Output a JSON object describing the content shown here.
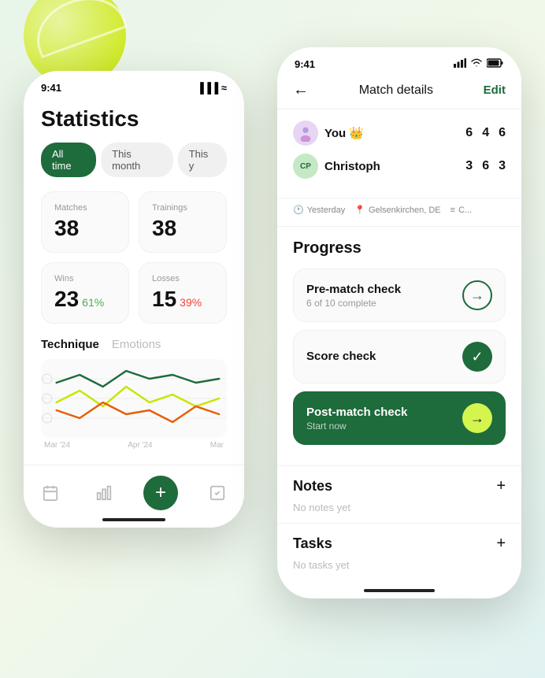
{
  "decoration": {
    "tennis_ball": "tennis-ball"
  },
  "left_phone": {
    "status_bar": {
      "time": "9:41",
      "signal": "▐▐▐",
      "wifi": "wifi"
    },
    "title": "Statistics",
    "filter_tabs": [
      {
        "label": "All time",
        "active": true
      },
      {
        "label": "This month",
        "active": false
      },
      {
        "label": "This y",
        "active": false
      }
    ],
    "stats": [
      {
        "label": "Matches",
        "value": "38",
        "percent": null
      },
      {
        "label": "Trainings",
        "value": "38",
        "percent": null
      },
      {
        "label": "Wins",
        "value": "23",
        "percent": "61%",
        "percent_color": "green"
      },
      {
        "label": "Losses",
        "value": "15",
        "percent": "39%",
        "percent_color": "red"
      }
    ],
    "chart_tabs": [
      {
        "label": "Technique",
        "active": true
      },
      {
        "label": "Emotions",
        "active": false
      }
    ],
    "chart_labels": [
      "Mar '24",
      "Apr '24",
      "Mar"
    ],
    "nav": [
      {
        "icon": "📅",
        "label": "calendar"
      },
      {
        "icon": "📊",
        "label": "stats"
      },
      {
        "icon": "+",
        "label": "add",
        "active": true
      },
      {
        "icon": "✓",
        "label": "tasks"
      }
    ]
  },
  "right_phone": {
    "status_bar": {
      "time": "9:41",
      "signal": "▐▐▐",
      "wifi": "wifi",
      "battery": "battery"
    },
    "header": {
      "back_icon": "←",
      "title": "Match details",
      "edit_label": "Edit"
    },
    "players": [
      {
        "name": "You",
        "avatar_type": "photo",
        "crown": true,
        "scores": [
          "6",
          "4",
          "6"
        ]
      },
      {
        "name": "Christoph",
        "avatar_type": "initials",
        "initials": "CP",
        "crown": false,
        "scores": [
          "3",
          "6",
          "3"
        ]
      }
    ],
    "match_meta": [
      {
        "icon": "🕐",
        "text": "Yesterday"
      },
      {
        "icon": "📍",
        "text": "Gelsenkirchen, DE"
      },
      {
        "icon": "≡",
        "text": "C..."
      }
    ],
    "progress": {
      "section_title": "Progress",
      "items": [
        {
          "title": "Pre-match check",
          "subtitle": "6 of 10 complete",
          "btn_type": "outline",
          "btn_icon": "→"
        },
        {
          "title": "Score check",
          "subtitle": null,
          "btn_type": "check",
          "btn_icon": "✓"
        },
        {
          "title": "Post-match check",
          "subtitle": "Start now",
          "btn_type": "yellow",
          "btn_icon": "→",
          "active": true
        }
      ]
    },
    "notes": {
      "title": "Notes",
      "add_icon": "+",
      "empty_text": "No notes yet"
    },
    "tasks": {
      "title": "Tasks",
      "add_icon": "+",
      "empty_text": "No tasks yet"
    }
  }
}
